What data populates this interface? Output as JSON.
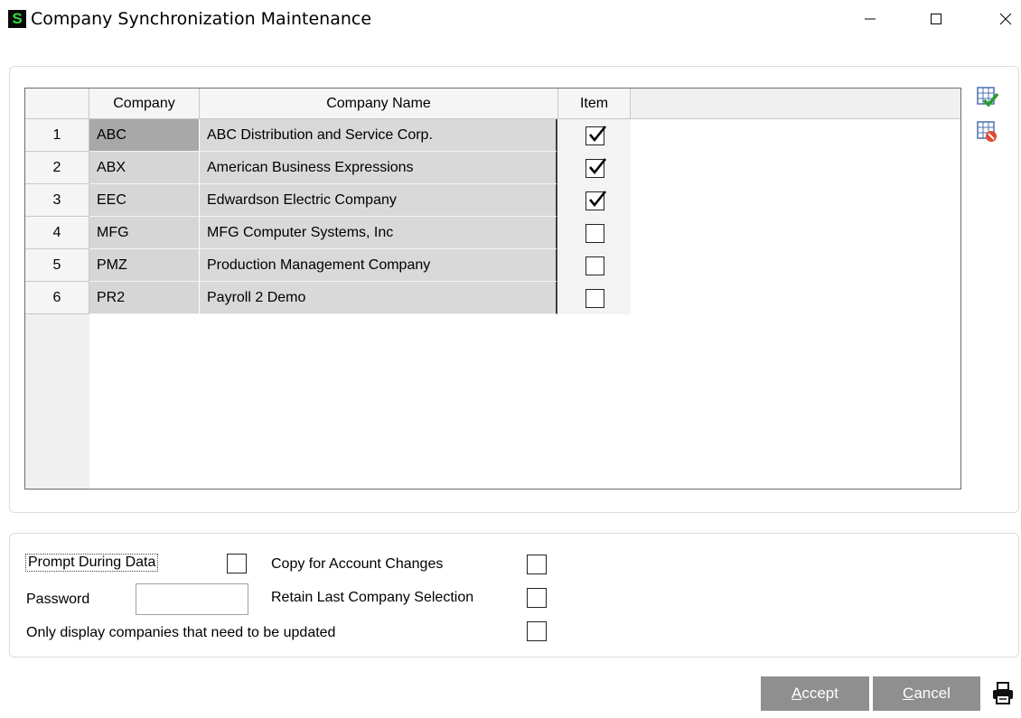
{
  "window": {
    "app_icon_letter": "S",
    "title": "Company Synchronization Maintenance"
  },
  "grid": {
    "columns": [
      "Company",
      "Company Name",
      "Item"
    ],
    "rows": [
      {
        "num": "1",
        "code": "ABC",
        "name": "ABC Distribution and Service Corp.",
        "item": true
      },
      {
        "num": "2",
        "code": "ABX",
        "name": "American Business Expressions",
        "item": true
      },
      {
        "num": "3",
        "code": "EEC",
        "name": "Edwardson Electric Company",
        "item": true
      },
      {
        "num": "4",
        "code": "MFG",
        "name": "MFG Computer Systems, Inc",
        "item": false
      },
      {
        "num": "5",
        "code": "PMZ",
        "name": "Production Management Company",
        "item": false
      },
      {
        "num": "6",
        "code": "PR2",
        "name": "Payroll 2 Demo",
        "item": false
      }
    ]
  },
  "side_icons": [
    "select-all-icon",
    "clear-all-icon"
  ],
  "options": {
    "prompt_during_data_label": "Prompt During Data",
    "prompt_during_data": false,
    "copy_for_account_changes_label": "Copy for Account Changes",
    "copy_for_account_changes": false,
    "password_label": "Password",
    "password_value": "",
    "retain_last_company_label": "Retain Last Company Selection",
    "retain_last_company": false,
    "only_display_label": "Only display companies that need to be updated",
    "only_display": false
  },
  "buttons": {
    "accept_accel": "A",
    "accept_rest": "ccept",
    "cancel_accel": "C",
    "cancel_rest": "ancel"
  },
  "colors": {
    "button_bg": "#8f8f8f",
    "app_icon_fg": "#2fdc3a"
  }
}
